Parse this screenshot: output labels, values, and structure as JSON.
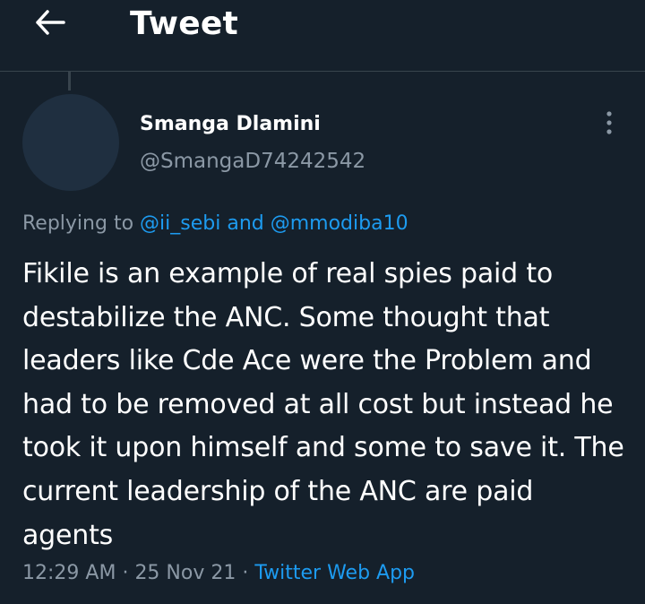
{
  "header": {
    "title": "Tweet",
    "back_icon": "arrow-left-icon"
  },
  "tweet": {
    "author": {
      "display_name": "Smanga Dlamini",
      "handle": "@SmangaD74242542"
    },
    "replying": {
      "prefix": "Replying to",
      "mention_1": "@ii_sebi",
      "conjunction": "and",
      "mention_2": "@mmodiba10"
    },
    "text": "Fikile is an example of real spies paid to destabilize the ANC. Some thought that leaders like Cde Ace were the Problem and had to be removed at all cost but instead he took it upon himself and some to save it. The current leadership of the ANC are paid agents",
    "meta": {
      "time": "12:29 AM",
      "separator_1": "·",
      "date": "25 Nov 21",
      "separator_2": "·",
      "source": "Twitter Web App"
    },
    "more_icon": "more-vertical-icon"
  },
  "colors": {
    "background": "#15202b",
    "text": "#ffffff",
    "secondary_text": "#8b98a5",
    "link": "#1d9bf0",
    "divider": "#38444d",
    "avatar_placeholder": "#1f2f40"
  }
}
